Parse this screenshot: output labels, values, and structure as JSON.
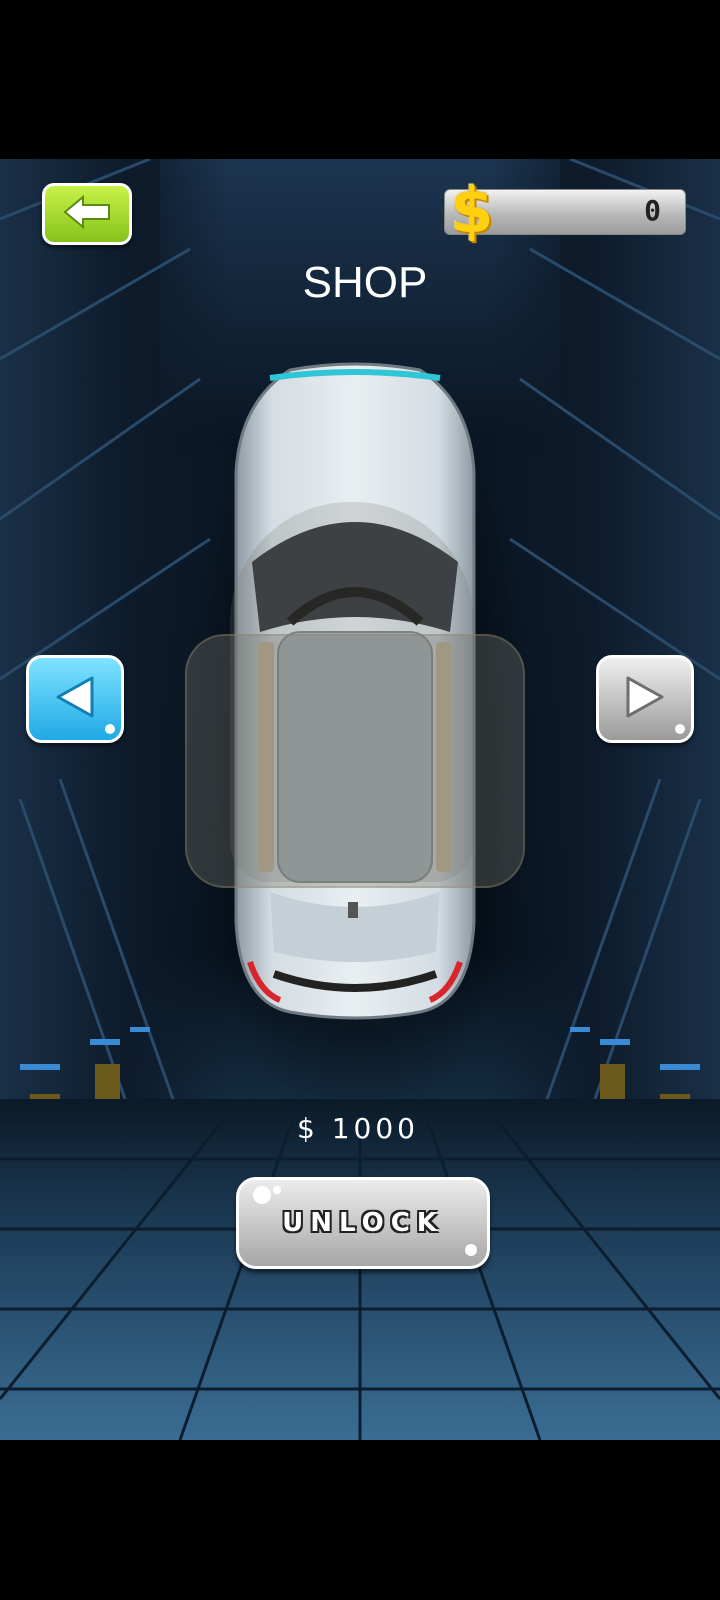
{
  "header": {
    "title": "SHOP",
    "coins": "0",
    "currency_icon": "dollar-coin-icon",
    "back_icon": "back-arrow-icon"
  },
  "navigation": {
    "prev_icon": "previous-car-arrow-icon",
    "next_icon": "next-car-arrow-icon"
  },
  "car": {
    "icon": "car-preview"
  },
  "purchase": {
    "price": "$ 1000",
    "unlock_label": "UNLOCK"
  },
  "colors": {
    "back_button": "#9ad62a",
    "prev_button": "#2bb6ee",
    "next_button": "#b8b8b8",
    "coin": "#ffcf12"
  }
}
